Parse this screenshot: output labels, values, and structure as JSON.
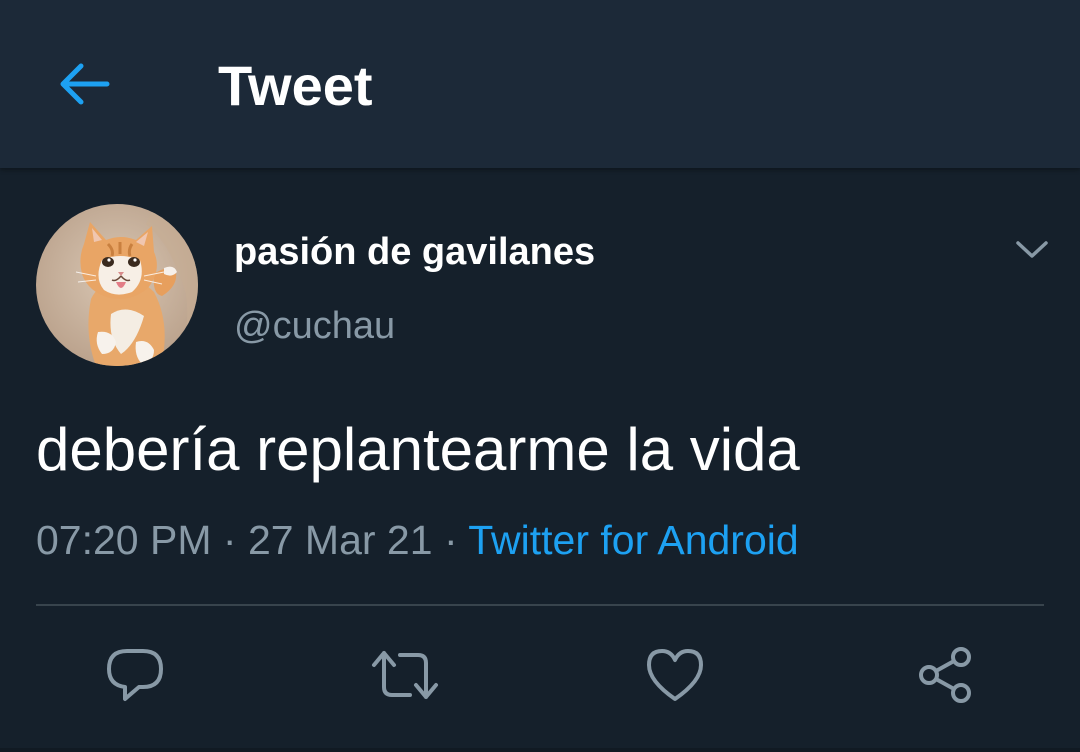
{
  "header": {
    "title": "Tweet",
    "back_icon": "arrow-left-icon"
  },
  "tweet": {
    "display_name": "pasión de gavilanes",
    "handle": "@cuchau",
    "text": "debería replantearme la vida",
    "time": "07:20 PM",
    "separator": " · ",
    "date": "27 Mar 21",
    "source": "Twitter for Android"
  },
  "actions": [
    {
      "name": "reply",
      "icon": "speech-bubble-icon"
    },
    {
      "name": "retweet",
      "icon": "retweet-icon"
    },
    {
      "name": "like",
      "icon": "heart-icon"
    },
    {
      "name": "share",
      "icon": "share-icon"
    }
  ],
  "colors": {
    "background": "#15202b",
    "header_background": "#1c2938",
    "accent": "#1da1f2",
    "secondary_text": "#8899a6",
    "divider": "#38444d"
  }
}
